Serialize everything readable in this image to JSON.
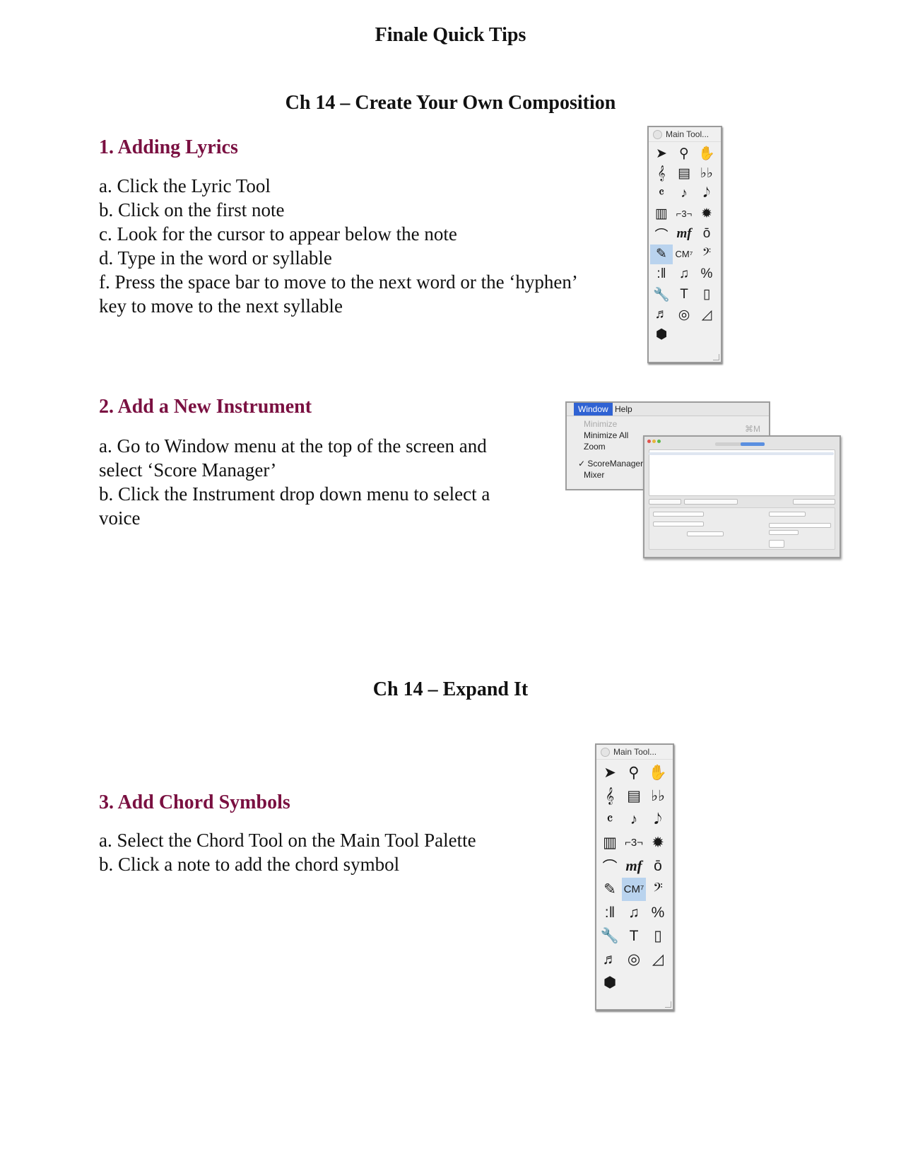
{
  "page_title": "Finale Quick Tips",
  "section1": {
    "title": "Ch 14 – Create Your Own Composition",
    "item1": {
      "heading": "1. Adding Lyrics",
      "steps": [
        "a. Click the Lyric Tool",
        "b. Click on the first note",
        "c. Look for the cursor to appear below the note",
        "d. Type in the word or syllable",
        "f. Press the space bar to move to the next word or the ‘hyphen’",
        "key to move to the next syllable"
      ]
    },
    "item2": {
      "heading": "2. Add a New Instrument",
      "steps": [
        "a. Go to Window menu at the top of the screen and",
        "select  ‘Score Manager’",
        "b. Click the Instrument drop down menu to select a",
        "voice"
      ]
    }
  },
  "section2": {
    "title": "Ch 14 – Expand It",
    "item3": {
      "heading": "3. Add Chord Symbols",
      "steps": [
        "a. Select the Chord Tool on the Main Tool Palette",
        "b. Click a note to add the chord symbol"
      ]
    }
  },
  "palette": {
    "title": "Main Tool...",
    "icons": [
      {
        "name": "selection-arrow-icon",
        "glyph": "➤"
      },
      {
        "name": "zoom-icon",
        "glyph": "⚲"
      },
      {
        "name": "hand-grabber-icon",
        "glyph": "✋"
      },
      {
        "name": "staff-icon",
        "glyph": "𝄞"
      },
      {
        "name": "measure-icon",
        "glyph": "▤"
      },
      {
        "name": "key-signature-icon",
        "glyph": "♭♭"
      },
      {
        "name": "time-signature-icon",
        "glyph": "𝄴"
      },
      {
        "name": "simple-entry-icon",
        "glyph": "♪"
      },
      {
        "name": "speedy-entry-icon",
        "glyph": "𝅘𝅥𝅮"
      },
      {
        "name": "hyperscribe-icon",
        "glyph": "▥"
      },
      {
        "name": "tuplet-icon",
        "glyph": "⌐3¬"
      },
      {
        "name": "midi-icon",
        "glyph": "✹"
      },
      {
        "name": "smart-shape-icon",
        "glyph": "⌒"
      },
      {
        "name": "expression-icon",
        "glyph": "mf"
      },
      {
        "name": "articulation-icon",
        "glyph": "ō"
      },
      {
        "name": "lyric-icon",
        "glyph": "✎"
      },
      {
        "name": "chord-icon",
        "glyph": "CM⁷"
      },
      {
        "name": "clef-icon",
        "glyph": "𝄢"
      },
      {
        "name": "repeat-icon",
        "glyph": ":‖"
      },
      {
        "name": "mirror-icon",
        "glyph": "♫"
      },
      {
        "name": "percent-icon",
        "glyph": "%"
      },
      {
        "name": "special-tools-icon",
        "glyph": "🔧"
      },
      {
        "name": "text-icon",
        "glyph": "T"
      },
      {
        "name": "page-layout-icon",
        "glyph": "▯"
      },
      {
        "name": "note-mover-icon",
        "glyph": "♬"
      },
      {
        "name": "resize-icon",
        "glyph": "◎"
      },
      {
        "name": "tempo-icon",
        "glyph": "◿"
      },
      {
        "name": "plugin-icon",
        "glyph": "⬢"
      }
    ]
  },
  "window_menu": {
    "menu_window": "Window",
    "menu_help": "Help",
    "items": [
      "Minimize",
      "Minimize All",
      "Zoom",
      "✓ ScoreManager",
      "Mixer"
    ],
    "shortcut": "⌘M"
  },
  "colors": {
    "heading": "#7a1041",
    "selected_tool": "#b9d3ee",
    "menu_highlight": "#2f62d3"
  }
}
